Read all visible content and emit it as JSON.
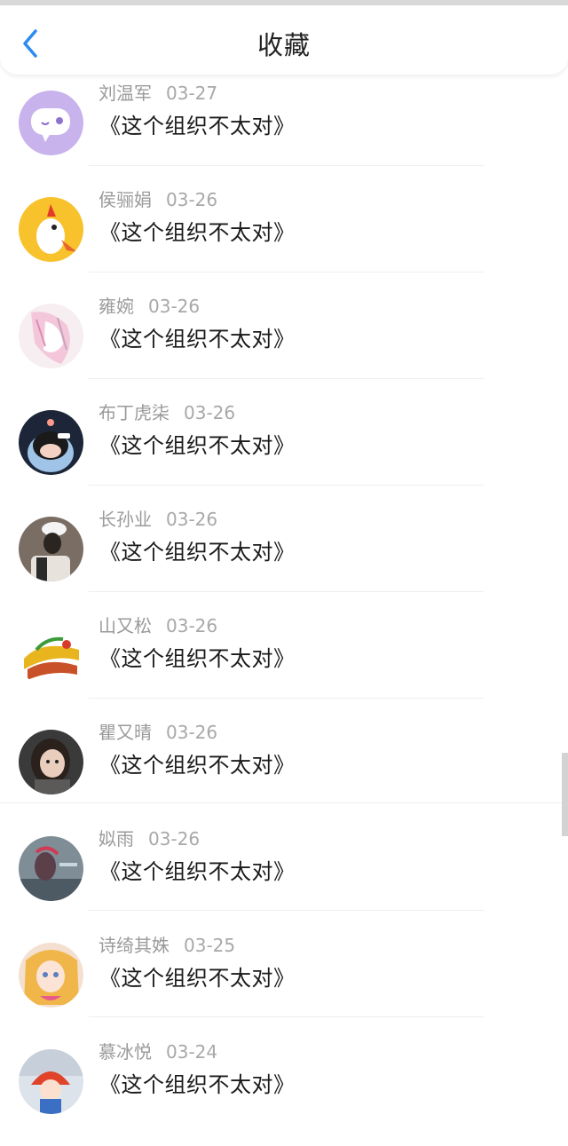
{
  "header": {
    "title": "收藏"
  },
  "items": [
    {
      "name": "刘温军",
      "date": "03-27",
      "topic": "《这个组织不太对》"
    },
    {
      "name": "侯骊娟",
      "date": "03-26",
      "topic": "《这个组织不太对》"
    },
    {
      "name": "雍婉",
      "date": "03-26",
      "topic": "《这个组织不太对》"
    },
    {
      "name": "布丁虎柒",
      "date": "03-26",
      "topic": "《这个组织不太对》"
    },
    {
      "name": "长孙业",
      "date": "03-26",
      "topic": "《这个组织不太对》"
    },
    {
      "name": "山又松",
      "date": "03-26",
      "topic": "《这个组织不太对》"
    },
    {
      "name": "瞿又晴",
      "date": "03-26",
      "topic": "《这个组织不太对》"
    },
    {
      "name": "姒雨",
      "date": "03-26",
      "topic": "《这个组织不太对》"
    },
    {
      "name": "诗绮其姝",
      "date": "03-25",
      "topic": "《这个组织不太对》"
    },
    {
      "name": "慕冰悦",
      "date": "03-24",
      "topic": "《这个组织不太对》"
    }
  ],
  "colors": {
    "accent": "#2b8bf2",
    "name_text": "#9a9a9a",
    "topic_text": "#1a1a1a"
  },
  "icons": {
    "back": "chevron-left-icon"
  }
}
